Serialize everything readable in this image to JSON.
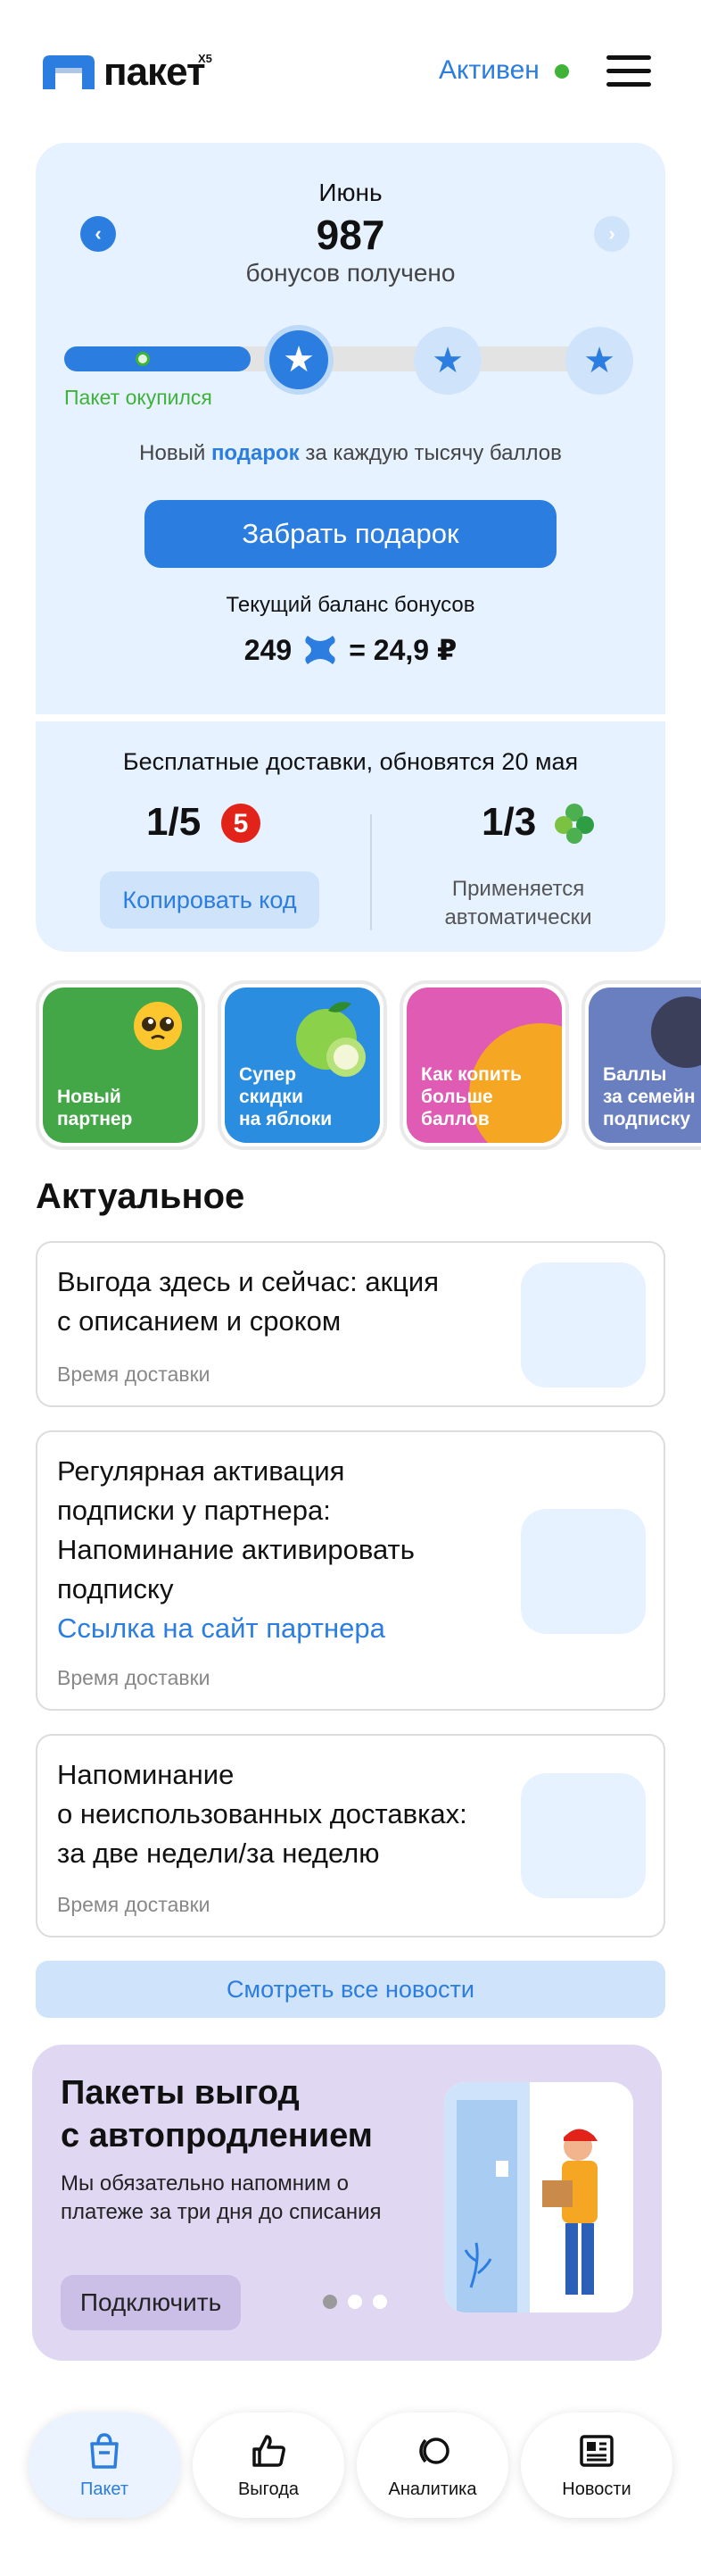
{
  "header": {
    "logo_text": "пакет",
    "logo_sup": "X5",
    "status": "Активен",
    "status_color": "#3fb238",
    "menu_icon": "hamburger-menu-icon"
  },
  "bonus": {
    "month": "Июнь",
    "value": "987",
    "subtitle": "бонусов получено",
    "progress_fraction": 0.36,
    "milestone_label": "Пакет окупился",
    "gift_note_prefix": "Новый",
    "gift_note_link": "подарок",
    "gift_note_suffix": "за каждую тысячу баллов",
    "gift_button": "Забрать подарок",
    "balance_label": "Текущий баланс бонусов",
    "balance_points": "249",
    "balance_equals": "= 24,9 ₽"
  },
  "delivery": {
    "title": "Бесплатные доставки, обновятся 20 мая",
    "left_count": "1/5",
    "left_store_icon": "pyaterochka-logo-icon",
    "copy_button": "Копировать код",
    "right_count": "1/3",
    "right_store_icon": "perekrestok-logo-icon",
    "auto_note_line1": "Применяется",
    "auto_note_line2": "автоматически"
  },
  "stories": [
    {
      "line1": "Новый",
      "line2": "партнер",
      "line3": "",
      "color": "#43a647"
    },
    {
      "line1": "Супер",
      "line2": "скидки",
      "line3": "на яблоки",
      "color": "#2b8de0"
    },
    {
      "line1": "Как копить",
      "line2": "больше",
      "line3": "баллов",
      "color": "#e05bb4"
    },
    {
      "line1": "Баллы",
      "line2": "за семейн",
      "line3": "подписку",
      "color": "#6a7fc0"
    }
  ],
  "section_title": "Актуальное",
  "news": [
    {
      "line1": "Выгода здесь и сейчас: акция",
      "line2": "с описанием и сроком",
      "time": "Время доставки"
    },
    {
      "line1": "Регулярная активация",
      "line2": "подписки у партнера:",
      "line3": "Напоминание активировать",
      "line4": "подписку",
      "link": "Ссылка на сайт партнера",
      "time": "Время доставки"
    },
    {
      "line1": "Напоминание",
      "line2": "о неиспользованных доставках:",
      "line3": "за две недели/за неделю",
      "time": "Время доставки"
    }
  ],
  "all_news_button": "Смотреть все новости",
  "promo": {
    "title_line1": "Пакеты выгод",
    "title_line2": "с автопродлением",
    "text": "Мы обязательно напомним о платеже за три дня до списания",
    "button": "Подключить",
    "dots_total": 3,
    "dots_active": 0
  },
  "nav": [
    {
      "label": "Пакет",
      "icon": "shopping-bag-icon",
      "active": true
    },
    {
      "label": "Выгода",
      "icon": "thumbs-up-icon",
      "active": false
    },
    {
      "label": "Аналитика",
      "icon": "analytics-circles-icon",
      "active": false
    },
    {
      "label": "Новости",
      "icon": "newspaper-icon",
      "active": false
    }
  ],
  "accent_color": "#2b7de0"
}
